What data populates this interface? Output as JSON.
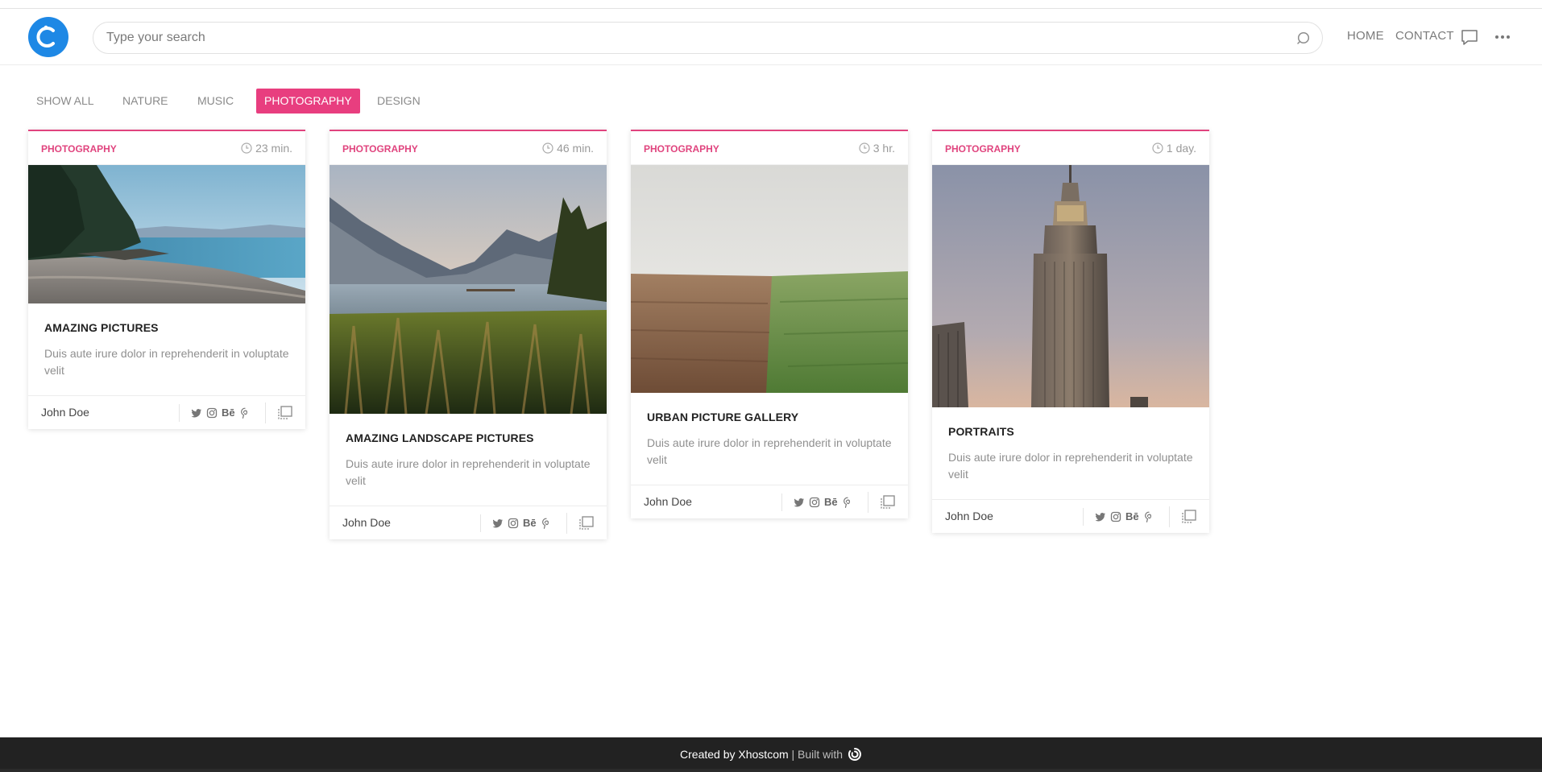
{
  "header": {
    "search_placeholder": "Type your search",
    "nav": {
      "home": "HOME",
      "contact": "CONTACT"
    },
    "icons": {
      "logo": "logo-icon",
      "search": "search-icon",
      "chat": "chat-icon",
      "more": "more-icon"
    }
  },
  "filters": [
    "SHOW ALL",
    "NATURE",
    "MUSIC",
    "PHOTOGRAPHY",
    "DESIGN"
  ],
  "active_filter": "PHOTOGRAPHY",
  "colors": {
    "accent": "#e83e7f",
    "logo": "#1e88e5",
    "footer": "#222222"
  },
  "cards": [
    {
      "category": "PHOTOGRAPHY",
      "time": "23 min.",
      "title": "AMAZING PICTURES",
      "desc": "Duis aute irure dolor in reprehenderit in voluptate velit",
      "author": "John Doe",
      "image": "beach-shoreline-photo"
    },
    {
      "category": "PHOTOGRAPHY",
      "time": "46 min.",
      "title": "AMAZING LANDSCAPE PICTURES",
      "desc": "Duis aute irure dolor in reprehenderit in voluptate velit",
      "author": "John Doe",
      "image": "mountain-lake-photo"
    },
    {
      "category": "PHOTOGRAPHY",
      "time": "3 hr.",
      "title": "URBAN PICTURE GALLERY",
      "desc": "Duis aute irure dolor in reprehenderit in voluptate velit",
      "author": "John Doe",
      "image": "field-photo"
    },
    {
      "category": "PHOTOGRAPHY",
      "time": "1 day.",
      "title": "PORTRAITS",
      "desc": "Duis aute irure dolor in reprehenderit in voluptate velit",
      "author": "John Doe",
      "image": "skyscraper-photo"
    }
  ],
  "share": {
    "behance": "Bē",
    "icons": [
      "twitter-icon",
      "instagram-icon",
      "behance-icon",
      "pinterest-icon",
      "bookmark-icon"
    ]
  },
  "footer": {
    "created": "Created by Xhostcom",
    "built": "| Built with"
  }
}
